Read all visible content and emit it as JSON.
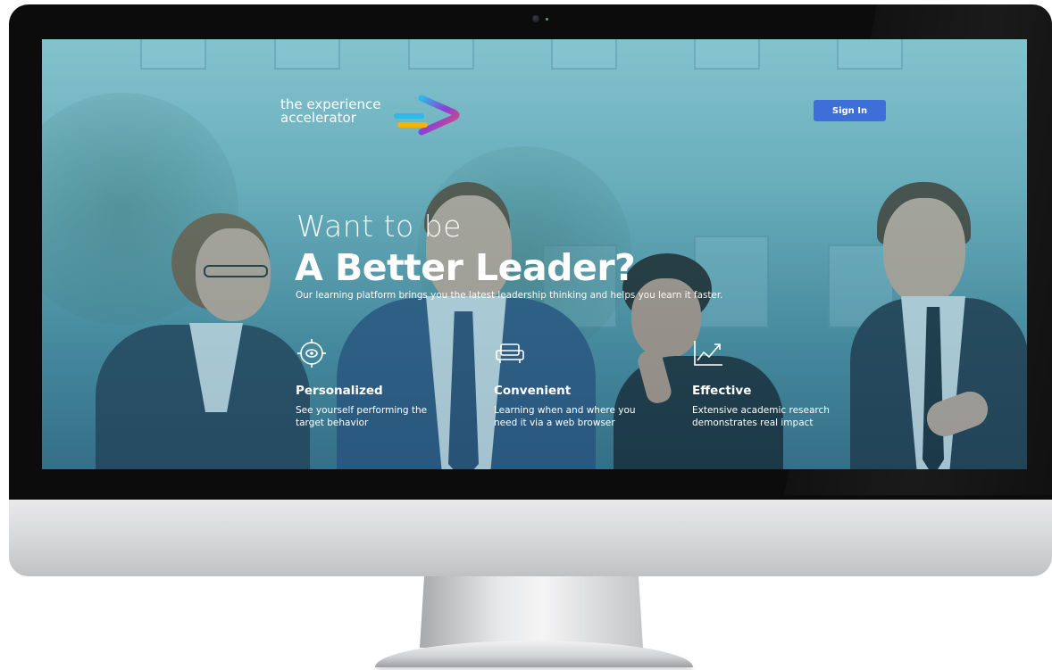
{
  "header": {
    "logo_line1": "the experience",
    "logo_line2": "accelerator",
    "signin_label": "Sign In"
  },
  "hero": {
    "kicker": "Want to be",
    "headline": "A Better Leader?",
    "subline": "Our learning platform brings you the latest leadership thinking and helps you learn it faster."
  },
  "features": [
    {
      "icon": "target-icon",
      "title": "Personalized",
      "description": "See yourself performing the target behavior"
    },
    {
      "icon": "sofa-icon",
      "title": "Convenient",
      "description": "Learning when and where you need it via a web browser"
    },
    {
      "icon": "chart-trend-icon",
      "title": "Effective",
      "description": "Extensive academic research demonstrates real impact"
    }
  ],
  "colors": {
    "accent": "#3e6ed8",
    "logo_gradient": [
      "#f5b400",
      "#f04a6a",
      "#8a3fd8",
      "#2fb8e8"
    ]
  }
}
